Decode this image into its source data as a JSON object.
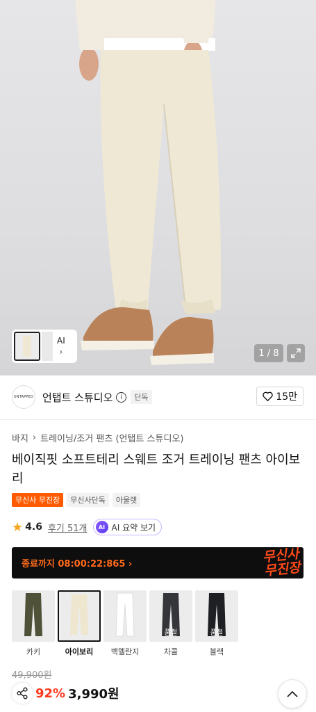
{
  "hero": {
    "thumb_ai_label": "AI",
    "counter": "1 / 8"
  },
  "brand": {
    "logo_text": "UNTAPPED",
    "name": "언탭트 스튜디오",
    "tag": "단독",
    "likes": "15만"
  },
  "product": {
    "breadcrumb": [
      "바지",
      "트레이닝/조거 팬츠 (언탭트 스튜디오)"
    ],
    "title": "베이직핏 소프트테리 스웨트 조거 트레이닝 팬츠 아이보리",
    "tags": [
      "무신사 무진장",
      "무신사단독",
      "아울렛"
    ],
    "rating": "4.6",
    "reviews": "후기 51개",
    "ai_summary": "AI 요약 보기",
    "ai_badge": "AI"
  },
  "banner": {
    "countdown": "종료까지 08:00:22:865 ›",
    "logo_line1": "무신사",
    "logo_line2": "무진장"
  },
  "options": [
    {
      "label": "카키",
      "color": "#4f5138",
      "sold": ""
    },
    {
      "label": "아이보리",
      "color": "#efe6cf",
      "sold": ""
    },
    {
      "label": "백멜란지",
      "color": "#f1f1f1",
      "sold": ""
    },
    {
      "label": "차콜",
      "color": "#35363a",
      "sold": "품절"
    },
    {
      "label": "블랙",
      "color": "#1f2023",
      "sold": "품절"
    }
  ],
  "price": {
    "original": "49,900원",
    "discount": "92%",
    "final": "3,990원"
  },
  "colors": {
    "accent": "#ff5a00",
    "pants": "#efe8d5"
  }
}
